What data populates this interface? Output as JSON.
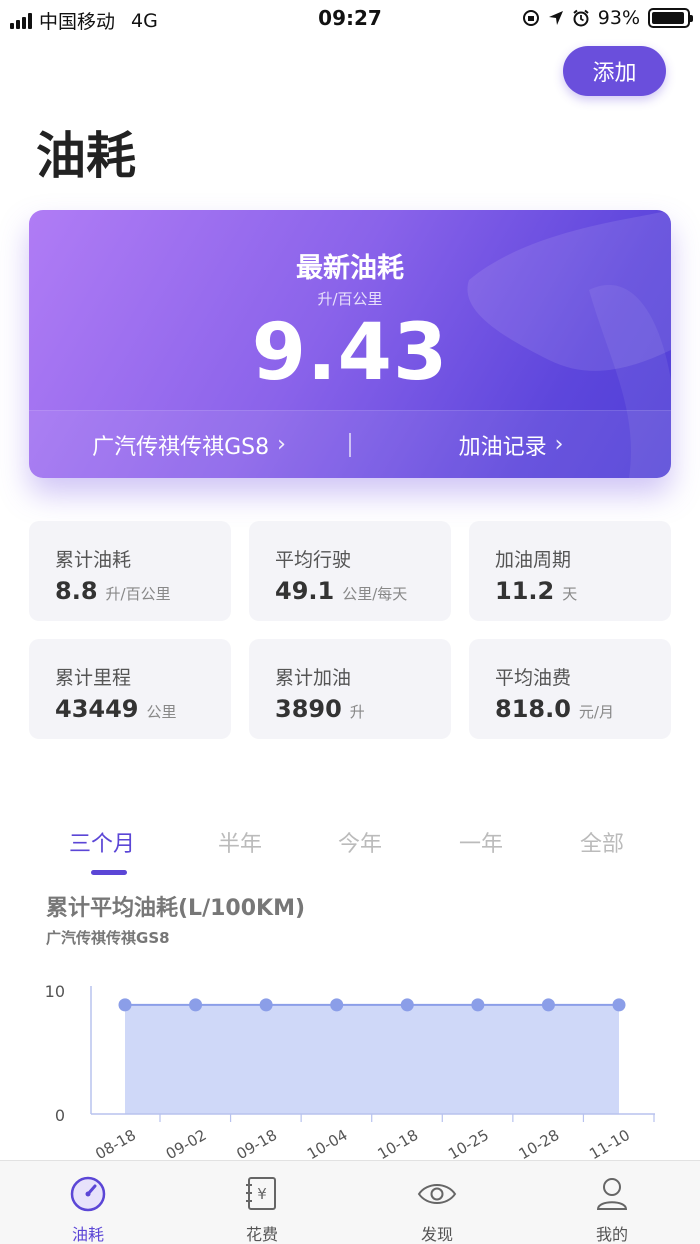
{
  "status_bar": {
    "carrier": "中国移动",
    "network": "4G",
    "time": "09:27",
    "battery": "93%",
    "battery_level": 0.93
  },
  "header": {
    "add_label": "添加",
    "title": "油耗"
  },
  "hero": {
    "title": "最新油耗",
    "unit": "升/百公里",
    "value": "9.43",
    "car_link": "广汽传祺传祺GS8",
    "record_link": "加油记录"
  },
  "stats": [
    {
      "label": "累计油耗",
      "value": "8.8",
      "unit": "升/百公里"
    },
    {
      "label": "平均行驶",
      "value": "49.1",
      "unit": "公里/每天"
    },
    {
      "label": "加油周期",
      "value": "11.2",
      "unit": "天"
    },
    {
      "label": "累计里程",
      "value": "43449",
      "unit": "公里"
    },
    {
      "label": "累计加油",
      "value": "3890",
      "unit": "升"
    },
    {
      "label": "平均油费",
      "value": "818.0",
      "unit": "元/月"
    }
  ],
  "period_tabs": [
    "三个月",
    "半年",
    "今年",
    "一年",
    "全部"
  ],
  "chart": {
    "title": "累计平均油耗(L/100KM)",
    "subtitle": "广汽传祺传祺GS8"
  },
  "chart_data": {
    "type": "area",
    "categories": [
      "08-18",
      "09-02",
      "09-18",
      "10-04",
      "10-18",
      "10-25",
      "10-28",
      "11-10"
    ],
    "values": [
      8.8,
      8.8,
      8.8,
      8.8,
      8.8,
      8.8,
      8.8,
      8.8
    ],
    "ylim": [
      0,
      10
    ],
    "yticks": [
      "0",
      "10"
    ],
    "grid": false,
    "fill_color": "#cfd8f8",
    "line_color": "#8b9ee8"
  },
  "nav": [
    {
      "label": "油耗",
      "icon": "gauge-icon"
    },
    {
      "label": "花费",
      "icon": "yen-book-icon"
    },
    {
      "label": "发现",
      "icon": "eye-icon"
    },
    {
      "label": "我的",
      "icon": "user-icon"
    }
  ],
  "colors": {
    "accent": "#5b46d6",
    "card_gradient_start": "#b07cf5",
    "card_gradient_end": "#4f3fd6"
  }
}
